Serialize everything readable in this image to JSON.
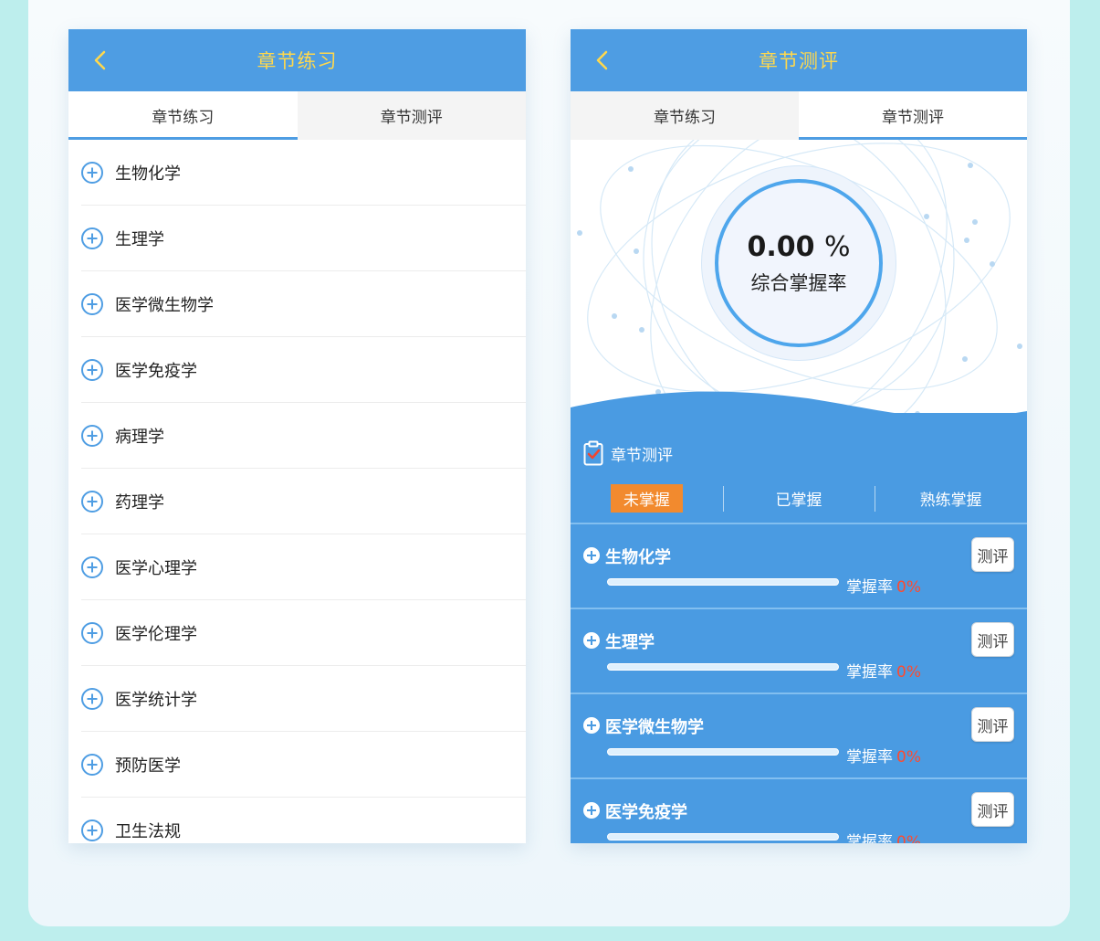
{
  "left": {
    "title": "章节练习",
    "tabs": [
      {
        "label": "章节练习",
        "active": true
      },
      {
        "label": "章节测评",
        "active": false
      }
    ],
    "items": [
      {
        "label": "生物化学"
      },
      {
        "label": "生理学"
      },
      {
        "label": "医学微生物学"
      },
      {
        "label": "医学免疫学"
      },
      {
        "label": "病理学"
      },
      {
        "label": "药理学"
      },
      {
        "label": "医学心理学"
      },
      {
        "label": "医学伦理学"
      },
      {
        "label": "医学统计学"
      },
      {
        "label": "预防医学"
      },
      {
        "label": "卫生法规"
      }
    ]
  },
  "right": {
    "title": "章节测评",
    "tabs": [
      {
        "label": "章节练习",
        "active": false
      },
      {
        "label": "章节测评",
        "active": true
      }
    ],
    "overall_rate": "0.00",
    "overall_unit": "%",
    "overall_label": "综合掌握率",
    "section_title": "章节测评",
    "filters": [
      {
        "label": "未掌握",
        "active": true
      },
      {
        "label": "已掌握",
        "active": false
      },
      {
        "label": "熟练掌握",
        "active": false
      }
    ],
    "rate_label": "掌握率",
    "eval_button": "测评",
    "subjects": [
      {
        "name": "生物化学",
        "rate": "0%",
        "progress": 0
      },
      {
        "name": "生理学",
        "rate": "0%",
        "progress": 0
      },
      {
        "name": "医学微生物学",
        "rate": "0%",
        "progress": 0
      },
      {
        "name": "医学免疫学",
        "rate": "0%",
        "progress": 0
      }
    ]
  },
  "colors": {
    "nav_blue": "#4e9de3",
    "title_yellow": "#ffd84d",
    "active_filter": "#f28a2e",
    "rate_red": "#ff4a2e"
  },
  "icons": {
    "back": "chevron-left-icon",
    "plus": "plus-circle-icon",
    "clipboard": "clipboard-check-icon"
  }
}
